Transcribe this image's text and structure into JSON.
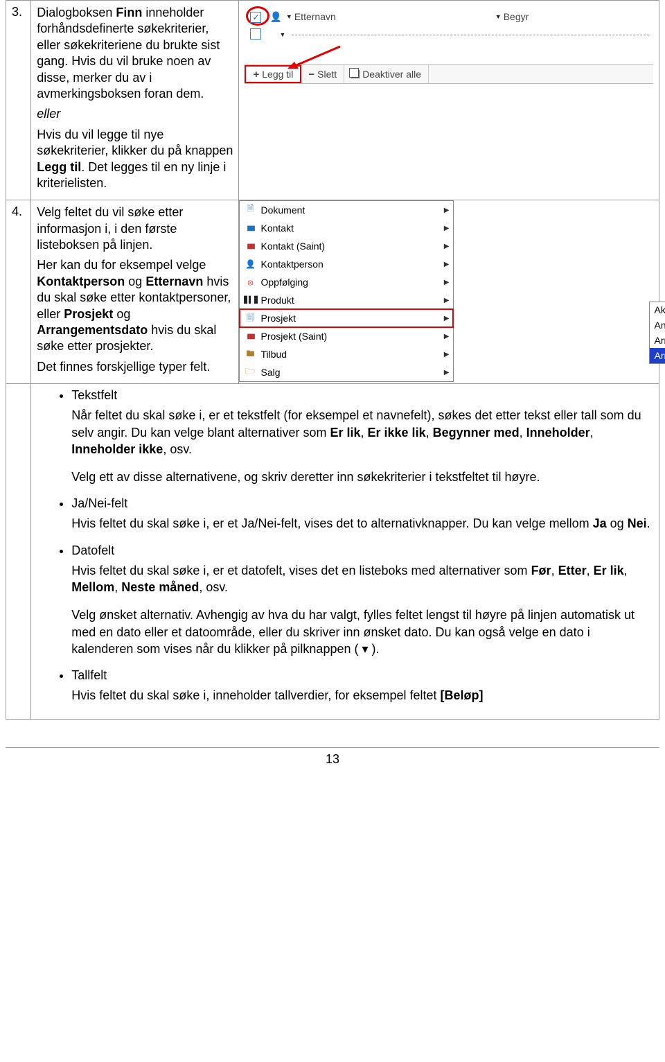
{
  "rows": {
    "r3": {
      "num": "3.",
      "p1a": "Dialogboksen ",
      "p1b": "Finn",
      "p1c": " inneholder forhåndsdefinerte søkekriterier, eller søkekriteriene du brukte sist gang. Hvis du vil bruke noen av disse, merker du av i avmerkingsboksen foran dem.",
      "eller": "eller",
      "p2a": "Hvis du vil legge til nye søkekriterier, klikker du på knappen ",
      "p2b": "Legg til",
      "p2c": ". Det legges til en ny linje i kriterielisten."
    },
    "r4": {
      "num": "4.",
      "p1": "Velg feltet du vil søke etter informasjon i, i den første listeboksen på linjen.",
      "p2a": "Her kan du for eksempel velge ",
      "p2b": "Kontaktperson",
      "p2c": " og ",
      "p2d": "Etternavn",
      "p2e": " hvis du skal søke etter kontaktpersoner, eller ",
      "p2f": "Prosjekt",
      "p2g": " og ",
      "p2h": "Arrangementsdato",
      "p2i": " hvis du skal søke etter prosjekter.",
      "p3": "Det finnes forskjellige typer felt."
    }
  },
  "shot1": {
    "check": "✓",
    "dd1": "Etternavn",
    "dd2": "Begyr",
    "legg_til": "Legg til",
    "slett": "Slett",
    "deaktiver": "Deaktiver alle"
  },
  "shot2": {
    "items": [
      {
        "icon": "doc",
        "label": "Dokument"
      },
      {
        "icon": "bars",
        "label": "Kontakt"
      },
      {
        "icon": "bars-r",
        "label": "Kontakt (Saint)"
      },
      {
        "icon": "person",
        "label": "Kontaktperson"
      },
      {
        "icon": "clock",
        "label": "Oppfølging"
      },
      {
        "icon": "barcode",
        "label": "Produkt"
      },
      {
        "icon": "prosj",
        "label": "Prosjekt"
      },
      {
        "icon": "bars-r",
        "label": "Prosjekt (Saint)"
      },
      {
        "icon": "tilbud",
        "label": "Tilbud"
      },
      {
        "icon": "salg",
        "label": "Salg"
      }
    ],
    "submenu": [
      "Aktiv ERP Sync",
      "Andre grupper",
      "Arrangement",
      "Arrangementsdato"
    ]
  },
  "bullets": {
    "tekstfelt": "Tekstfelt",
    "tekst_p1a": "Når feltet du skal søke i, er et tekstfelt (for eksempel et navnefelt), søkes det etter tekst eller tall som du selv angir. Du kan velge blant alternativer som ",
    "tb1": "Er lik",
    "c": ", ",
    "tb2": "Er ikke lik",
    "tb3": "Begynner med",
    "tb4": "Inneholder",
    "tb5": "Inneholder ikke",
    "osv": ", osv.",
    "tekst_p2": "Velg ett av disse alternativene, og skriv deretter inn søkekriterier i tekstfeltet til høyre.",
    "janei": "Ja/Nei-felt",
    "janei_p_a": "Hvis feltet du skal søke i, er et Ja/Nei-felt, vises det to alternativknapper. Du kan velge mellom ",
    "jb1": "Ja",
    "og": " og ",
    "jb2": "Nei",
    "dot": ".",
    "dato": "Datofelt",
    "dato_p1a": "Hvis feltet du skal søke i, er et datofelt, vises det en listeboks med alternativer som ",
    "db1": "Før",
    "db2": "Etter",
    "db3": "Er lik",
    "db4": "Mellom",
    "db5": "Neste måned",
    "dato_p2": "Velg ønsket alternativ. Avhengig av hva du har valgt, fylles feltet lengst til høyre på linjen automatisk ut med en dato eller et datoområde, eller du skriver inn ønsket dato. Du kan også velge en dato i kalenderen som vises når du klikker på pilknappen (   ▾   ).",
    "tall": "Tallfelt",
    "tall_p_a": "Hvis feltet du skal søke i, inneholder tallverdier, for eksempel feltet ",
    "tall_b": "[Beløp]"
  },
  "pagenum": "13"
}
